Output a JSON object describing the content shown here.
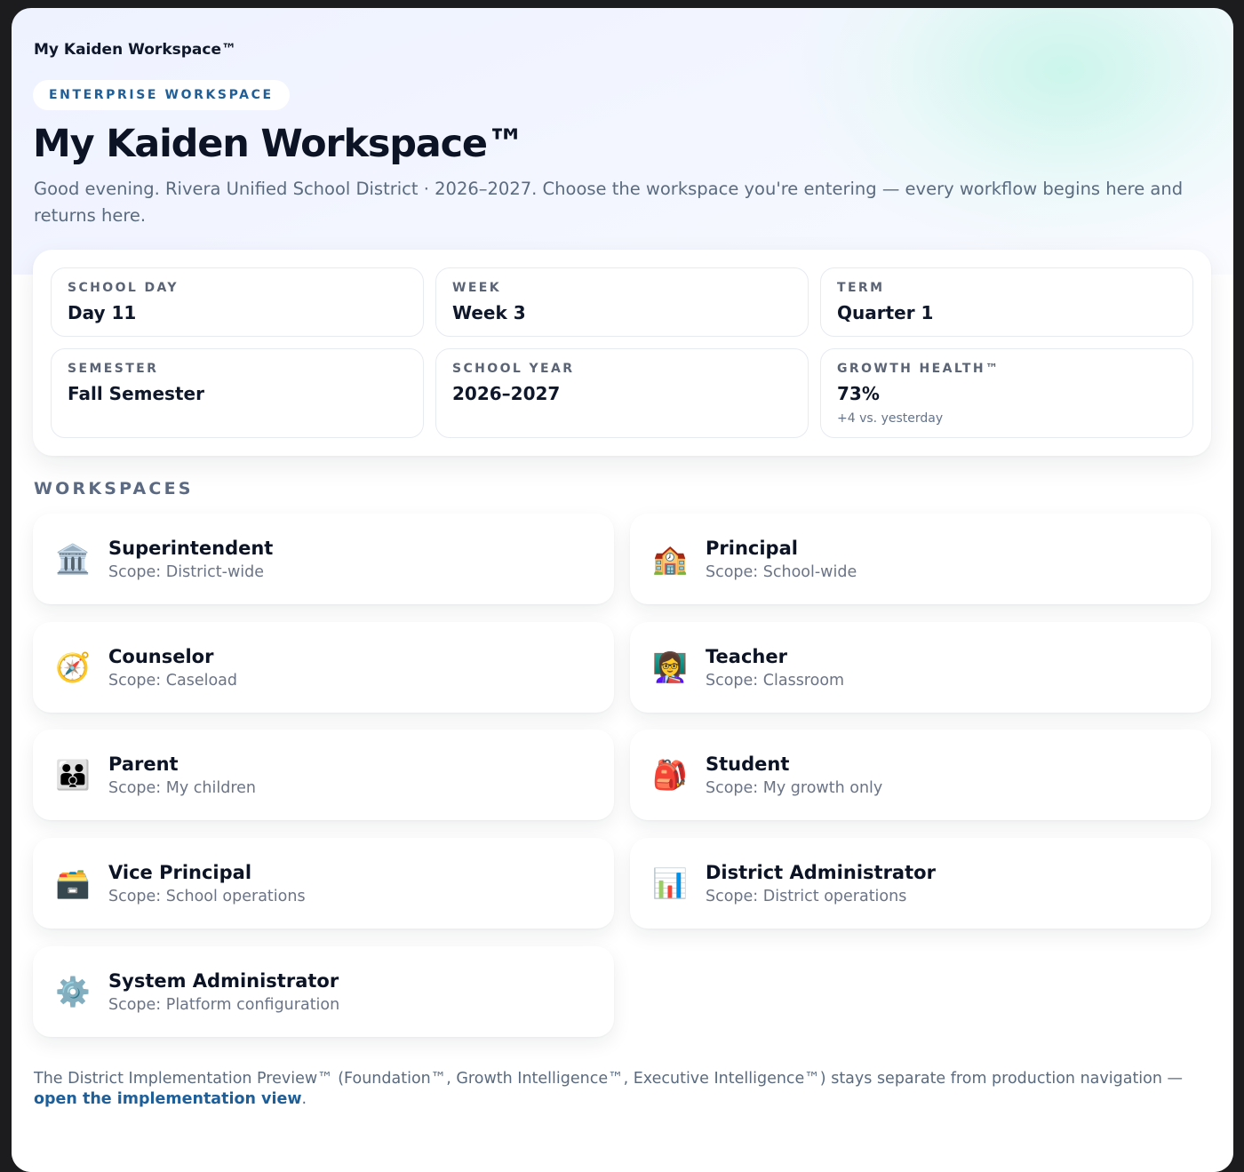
{
  "app": {
    "title": "My Kaiden Workspace™"
  },
  "hero": {
    "pill": "ENTERPRISE WORKSPACE",
    "title": "My Kaiden Workspace™",
    "subtitle": "Good evening. Rivera Unified School District · 2026–2027. Choose the workspace you're entering — every workflow begins here and returns here."
  },
  "stats": [
    {
      "label": "SCHOOL DAY",
      "value": "Day 11",
      "delta": ""
    },
    {
      "label": "WEEK",
      "value": "Week 3",
      "delta": ""
    },
    {
      "label": "TERM",
      "value": "Quarter 1",
      "delta": ""
    },
    {
      "label": "SEMESTER",
      "value": "Fall Semester",
      "delta": ""
    },
    {
      "label": "SCHOOL YEAR",
      "value": "2026–2027",
      "delta": ""
    },
    {
      "label": "GROWTH HEALTH™",
      "value": "73%",
      "delta": "+4 vs. yesterday"
    }
  ],
  "workspaces_heading": "WORKSPACES",
  "workspaces": [
    {
      "name": "Superintendent",
      "scope": "Scope: District-wide",
      "icon": "classical-building-icon",
      "glyph": "🏛️"
    },
    {
      "name": "Principal",
      "scope": "Scope: School-wide",
      "icon": "school-icon",
      "glyph": "🏫"
    },
    {
      "name": "Counselor",
      "scope": "Scope: Caseload",
      "icon": "compass-icon",
      "glyph": "🧭"
    },
    {
      "name": "Teacher",
      "scope": "Scope: Classroom",
      "icon": "teacher-icon",
      "glyph": "👩‍🏫"
    },
    {
      "name": "Parent",
      "scope": "Scope: My children",
      "icon": "family-icon",
      "glyph": "👪"
    },
    {
      "name": "Student",
      "scope": "Scope: My growth only",
      "icon": "backpack-icon",
      "glyph": "🎒"
    },
    {
      "name": "Vice Principal",
      "scope": "Scope: School operations",
      "icon": "card-file-box-icon",
      "glyph": "🗃️"
    },
    {
      "name": "District Administrator",
      "scope": "Scope: District operations",
      "icon": "bar-chart-icon",
      "glyph": "📊"
    },
    {
      "name": "System Administrator",
      "scope": "Scope: Platform configuration",
      "icon": "gear-icon",
      "glyph": "⚙️"
    }
  ],
  "footer": {
    "text": "The District Implementation Preview™ (Foundation™, Growth Intelligence™, Executive Intelligence™) stays separate from production navigation — ",
    "link": "open the implementation view",
    "end": "."
  }
}
